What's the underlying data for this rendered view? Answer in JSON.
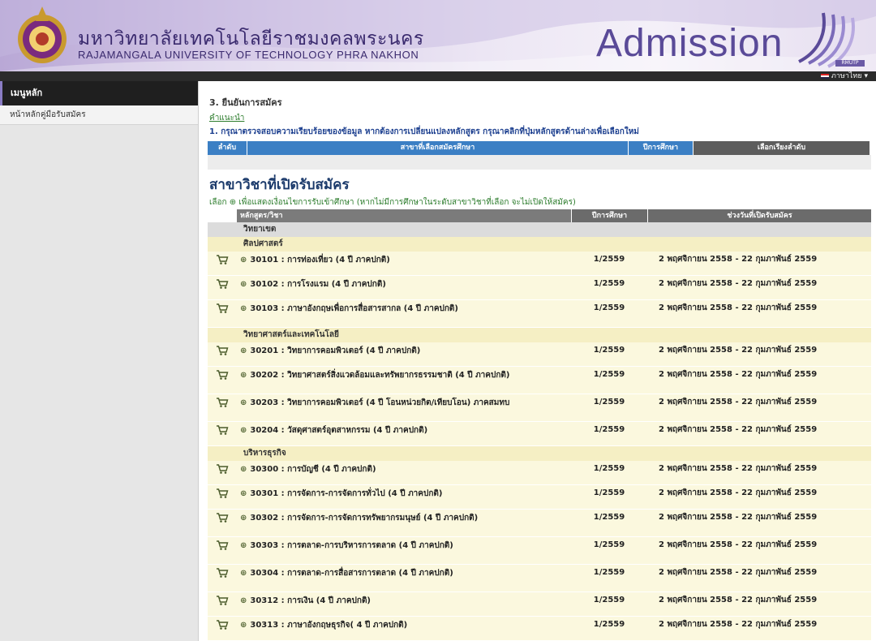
{
  "header": {
    "university_th": "มหาวิทยาลัยเทคโนโลยีราชมงคลพระนคร",
    "university_en": "RAJAMANGALA UNIVERSITY OF TECHNOLOGY PHRA NAKHON",
    "admission": "Admission",
    "logo_tag": "RMUTP",
    "language": "ภาษาไทย ▾"
  },
  "sidebar": {
    "title": "เมนูหลัก",
    "items": [
      {
        "label": "หน้าหลักคู่มือรับสมัคร",
        "icon": "document-icon"
      }
    ]
  },
  "main": {
    "step_title": "3. ยืนยันการสมัคร",
    "conditions_link": "คำแนะนำ",
    "instructions": "1. กรุณาตรวจสอบความเรียบร้อยของข้อมูล หากต้องการเปลี่ยนแปลงหลักสูตร กรุณาคลิกที่ปุ่มหลักสูตรด้านล่างเพื่อเลือกใหม่",
    "selected_header": {
      "col_no": "ลำดับ",
      "col_program": "สาขาที่เลือกสมัครศึกษา",
      "col_term": "ปีการศึกษา",
      "col_action": "เลือกเรียงลำดับ"
    },
    "section_title": "สาขาวิชาที่เปิดรับสมัคร",
    "legend": "เลือก ⊕ เพื่อแสดงเงื่อนไขการรับเข้าศึกษา (หากไม่มีการศึกษาในระดับสาขาวิชาที่เลือก จะไม่เปิดให้สมัคร)",
    "table_header": {
      "program": "หลักสูตร/วิชา",
      "term": "ปีการศึกษา",
      "period": "ช่วงวันที่เปิดรับสมัคร"
    },
    "campus": "วิทยาเขต",
    "groups": [
      {
        "faculty": "ศิลปศาสตร์",
        "rows": [
          {
            "name": "30101 : การท่องเที่ยว (4 ปี ภาคปกติ)",
            "term": "1/2559",
            "period": "2 พฤศจิกายน 2558 - 22 กุมภาพันธ์ 2559"
          },
          {
            "name": "30102 : การโรงแรม (4 ปี ภาคปกติ)",
            "term": "1/2559",
            "period": "2 พฤศจิกายน 2558 - 22 กุมภาพันธ์ 2559"
          },
          {
            "name": "30103 : ภาษาอังกฤษเพื่อการสื่อสารสากล (4 ปี ภาคปกติ)",
            "term": "1/2559",
            "period": "2 พฤศจิกายน 2558 - 22 กุมภาพันธ์ 2559"
          }
        ]
      },
      {
        "faculty": "วิทยาศาสตร์และเทคโนโลยี",
        "rows": [
          {
            "name": "30201 : วิทยาการคอมพิวเตอร์ (4 ปี ภาคปกติ)",
            "term": "1/2559",
            "period": "2 พฤศจิกายน 2558 - 22 กุมภาพันธ์ 2559"
          },
          {
            "name": "30202 : วิทยาศาสตร์สิ่งแวดล้อมและทรัพยากรธรรมชาติ (4 ปี ภาคปกติ)",
            "term": "1/2559",
            "period": "2 พฤศจิกายน 2558 - 22 กุมภาพันธ์ 2559"
          },
          {
            "name": "30203 : วิทยาการคอมพิวเตอร์ (4 ปี โอนหน่วยกิต/เทียบโอน) ภาคสมทบ",
            "term": "1/2559",
            "period": "2 พฤศจิกายน 2558 - 22 กุมภาพันธ์ 2559"
          },
          {
            "name": "30204 : วัสดุศาสตร์อุตสาหกรรม (4 ปี ภาคปกติ)",
            "term": "1/2559",
            "period": "2 พฤศจิกายน 2558 - 22 กุมภาพันธ์ 2559"
          }
        ]
      },
      {
        "faculty": "บริหารธุรกิจ",
        "rows": [
          {
            "name": "30300 : การบัญชี (4 ปี ภาคปกติ)",
            "term": "1/2559",
            "period": "2 พฤศจิกายน 2558 - 22 กุมภาพันธ์ 2559"
          },
          {
            "name": "30301 : การจัดการ-การจัดการทั่วไป (4 ปี ภาคปกติ)",
            "term": "1/2559",
            "period": "2 พฤศจิกายน 2558 - 22 กุมภาพันธ์ 2559"
          },
          {
            "name": "30302 : การจัดการ-การจัดการทรัพยากรมนุษย์ (4 ปี ภาคปกติ)",
            "term": "1/2559",
            "period": "2 พฤศจิกายน 2558 - 22 กุมภาพันธ์ 2559"
          },
          {
            "name": "30303 : การตลาด-การบริหารการตลาด (4 ปี ภาคปกติ)",
            "term": "1/2559",
            "period": "2 พฤศจิกายน 2558 - 22 กุมภาพันธ์ 2559"
          },
          {
            "name": "30304 : การตลาด-การสื่อสารการตลาด (4 ปี ภาคปกติ)",
            "term": "1/2559",
            "period": "2 พฤศจิกายน 2558 - 22 กุมภาพันธ์ 2559"
          },
          {
            "name": "30312 : การเงิน (4 ปี ภาคปกติ)",
            "term": "1/2559",
            "period": "2 พฤศจิกายน 2558 - 22 กุมภาพันธ์ 2559"
          },
          {
            "name": "30313 : ภาษาอังกฤษธุรกิจ( 4 ปี ภาคปกติ)",
            "term": "1/2559",
            "period": "2 พฤศจิกายน 2558 - 22 กุมภาพันธ์ 2559"
          }
        ]
      }
    ]
  },
  "colors": {
    "header_accent": "#5a4a98",
    "table_header": "#6b6b6b",
    "row_bg": "#fbf8de",
    "faculty_bg": "#f5efc4",
    "select_bar": "#3b7fc4"
  },
  "icons": {
    "row_action": "cart-icon",
    "expand": "plus-circle-icon",
    "seal": "university-seal-icon"
  }
}
